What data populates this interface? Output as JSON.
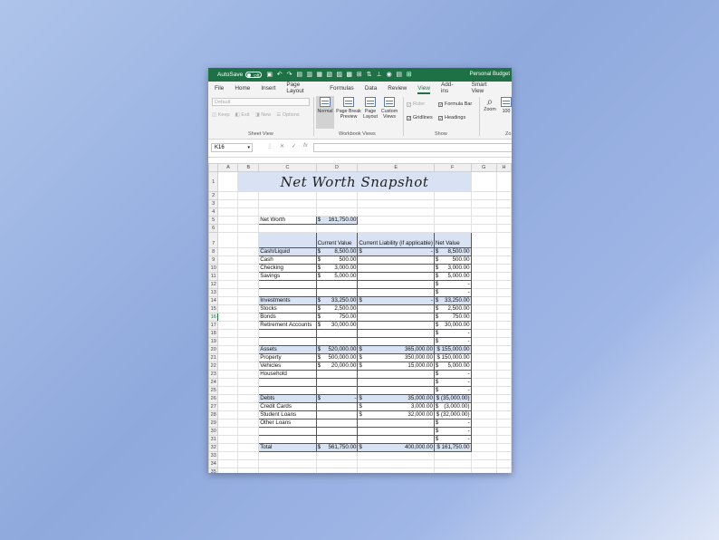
{
  "titlebar": {
    "autosave_label": "AutoSave",
    "autosave_state": "Off",
    "document_title": "Personal Budget"
  },
  "menu": [
    "File",
    "Home",
    "Insert",
    "Page Layout",
    "Formulas",
    "Data",
    "Review",
    "View",
    "Add-ins",
    "Smart View"
  ],
  "active_menu": "View",
  "ribbon": {
    "sheet_view": {
      "select_value": "Default",
      "keep": "Keep",
      "exit": "Exit",
      "new": "New",
      "options": "Options",
      "label": "Sheet View"
    },
    "workbook_views": {
      "normal": "Normal",
      "page_break": "Page Break Preview",
      "page_layout": "Page Layout",
      "custom_views": "Custom Views",
      "label": "Workbook Views"
    },
    "show": {
      "ruler": "Ruler",
      "formula_bar": "Formula Bar",
      "gridlines": "Gridlines",
      "headings": "Headings",
      "label": "Show"
    },
    "zoom": {
      "zoom": "Zoom",
      "hundred": "100",
      "label": "Zo"
    }
  },
  "formula_bar": {
    "name_box": "K16",
    "fx": "fx"
  },
  "columns": [
    "A",
    "B",
    "C",
    "D",
    "E",
    "F",
    "G",
    "H"
  ],
  "sheet": {
    "title": "Net Worth Snapshot",
    "net_worth_label": "Net Worth",
    "net_worth_value": "161,750.00",
    "headers": {
      "current_value": "Current Value",
      "current_liability": "Current Liability (if applicable)",
      "net_value": "Net Value"
    },
    "rows": [
      {
        "r": 8,
        "c": "Cash/Liquid",
        "d": "8,500.00",
        "e": "-",
        "f": "8,500.00",
        "sec": true,
        "dsign": "$",
        "esign": "$",
        "fsign": "$"
      },
      {
        "r": 9,
        "c": "Cash",
        "d": "500.00",
        "e": "",
        "f": "500.00",
        "dsign": "$",
        "esign": "",
        "fsign": "$"
      },
      {
        "r": 10,
        "c": "Checking",
        "d": "3,000.00",
        "e": "",
        "f": "3,000.00",
        "dsign": "$",
        "esign": "",
        "fsign": "$"
      },
      {
        "r": 11,
        "c": "Savings",
        "d": "5,000.00",
        "e": "",
        "f": "5,000.00",
        "dsign": "$",
        "esign": "",
        "fsign": "$"
      },
      {
        "r": 12,
        "c": "",
        "d": "",
        "e": "",
        "f": "-",
        "dsign": "",
        "esign": "",
        "fsign": "$"
      },
      {
        "r": 13,
        "c": "",
        "d": "",
        "e": "",
        "f": "-",
        "dsign": "",
        "esign": "",
        "fsign": "$"
      },
      {
        "r": 14,
        "c": "Investments",
        "d": "33,250.00",
        "e": "-",
        "f": "33,250.00",
        "sec": true,
        "dsign": "$",
        "esign": "$",
        "fsign": "$"
      },
      {
        "r": 15,
        "c": "Stocks",
        "d": "2,500.00",
        "e": "",
        "f": "2,500.00",
        "dsign": "$",
        "esign": "",
        "fsign": "$"
      },
      {
        "r": 16,
        "c": "Bonds",
        "d": "750.00",
        "e": "",
        "f": "750.00",
        "dsign": "$",
        "esign": "",
        "fsign": "$"
      },
      {
        "r": 17,
        "c": "Retirement Accounts",
        "d": "30,000.00",
        "e": "",
        "f": "30,000.00",
        "dsign": "$",
        "esign": "",
        "fsign": "$"
      },
      {
        "r": 18,
        "c": "",
        "d": "",
        "e": "",
        "f": "-",
        "dsign": "",
        "esign": "",
        "fsign": "$"
      },
      {
        "r": 19,
        "c": "",
        "d": "",
        "e": "",
        "f": "-",
        "dsign": "",
        "esign": "",
        "fsign": "$"
      },
      {
        "r": 20,
        "c": "Assets",
        "d": "520,000.00",
        "e": "365,000.00",
        "f": "$ 155,000.00",
        "sec": true,
        "dsign": "$",
        "esign": "$",
        "fsign": ""
      },
      {
        "r": 21,
        "c": "Property",
        "d": "500,000.00",
        "e": "350,000.00",
        "f": "$ 150,000.00",
        "dsign": "$",
        "esign": "$",
        "fsign": ""
      },
      {
        "r": 22,
        "c": "Vehicles",
        "d": "20,000.00",
        "e": "15,000.00",
        "f": "5,000.00",
        "dsign": "$",
        "esign": "$",
        "fsign": "$"
      },
      {
        "r": 23,
        "c": "Household",
        "d": "",
        "e": "",
        "f": "-",
        "dsign": "",
        "esign": "",
        "fsign": "$"
      },
      {
        "r": 24,
        "c": "",
        "d": "",
        "e": "",
        "f": "-",
        "dsign": "",
        "esign": "",
        "fsign": "$"
      },
      {
        "r": 25,
        "c": "",
        "d": "",
        "e": "",
        "f": "-",
        "dsign": "",
        "esign": "",
        "fsign": "$"
      },
      {
        "r": 26,
        "c": "Debts",
        "d": "-",
        "e": "35,000.00",
        "f": "$ (35,000.00)",
        "sec": true,
        "dsign": "$",
        "esign": "$",
        "fsign": ""
      },
      {
        "r": 27,
        "c": "Credit Cards",
        "d": "",
        "e": "3,000.00",
        "f": "(3,000.00)",
        "dsign": "",
        "esign": "$",
        "fsign": "$"
      },
      {
        "r": 28,
        "c": "Student Loans",
        "d": "",
        "e": "32,000.00",
        "f": "$ (32,000.00)",
        "dsign": "",
        "esign": "$",
        "fsign": ""
      },
      {
        "r": 29,
        "c": "Other Loans",
        "d": "",
        "e": "",
        "f": "-",
        "dsign": "",
        "esign": "",
        "fsign": "$"
      },
      {
        "r": 30,
        "c": "",
        "d": "",
        "e": "",
        "f": "-",
        "dsign": "",
        "esign": "",
        "fsign": "$"
      },
      {
        "r": 31,
        "c": "",
        "d": "",
        "e": "",
        "f": "-",
        "dsign": "",
        "esign": "",
        "fsign": "$"
      },
      {
        "r": 32,
        "c": "Total",
        "d": "561,750.00",
        "e": "400,000.00",
        "f": "$ 161,750.00",
        "sec": true,
        "dsign": "$",
        "esign": "$",
        "fsign": ""
      }
    ]
  }
}
